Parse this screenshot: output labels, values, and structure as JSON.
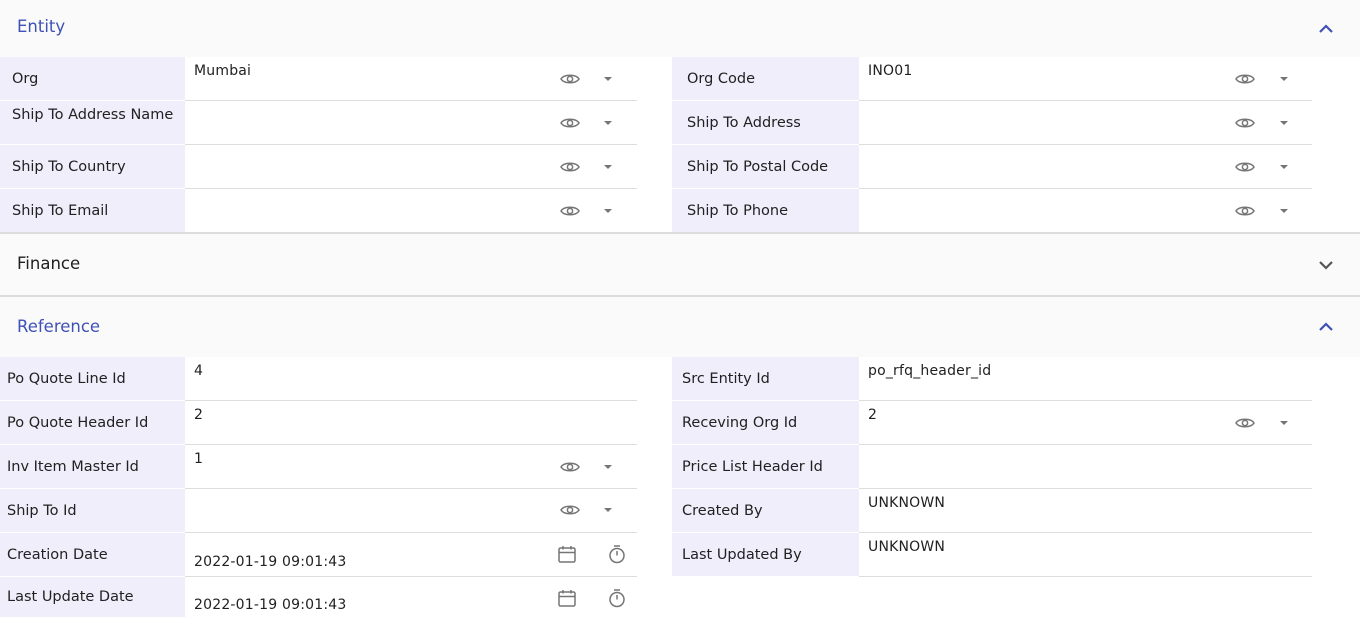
{
  "sections": {
    "entity": {
      "title": "Entity",
      "expanded": true
    },
    "finance": {
      "title": "Finance",
      "expanded": false
    },
    "reference": {
      "title": "Reference",
      "expanded": true
    }
  },
  "entity": {
    "org": {
      "label": "Org",
      "value": "Mumbai"
    },
    "org_code": {
      "label": "Org Code",
      "value": "INO01"
    },
    "ship_to_address_name": {
      "label": "Ship To Address Name",
      "value": ""
    },
    "ship_to_address": {
      "label": "Ship To Address",
      "value": ""
    },
    "ship_to_country": {
      "label": "Ship To Country",
      "value": ""
    },
    "ship_to_postal_code": {
      "label": "Ship To Postal Code",
      "value": ""
    },
    "ship_to_email": {
      "label": "Ship To Email",
      "value": ""
    },
    "ship_to_phone": {
      "label": "Ship To Phone",
      "value": ""
    }
  },
  "reference": {
    "po_quote_line_id": {
      "label": "Po Quote Line Id",
      "value": "4"
    },
    "src_entity_id": {
      "label": "Src Entity Id",
      "value": "po_rfq_header_id"
    },
    "po_quote_header_id": {
      "label": "Po Quote Header Id",
      "value": "2"
    },
    "receving_org_id": {
      "label": "Receving Org Id",
      "value": "2"
    },
    "inv_item_master_id": {
      "label": "Inv Item Master Id",
      "value": "1"
    },
    "price_list_header_id": {
      "label": "Price List Header Id",
      "value": ""
    },
    "ship_to_id": {
      "label": "Ship To Id",
      "value": ""
    },
    "created_by": {
      "label": "Created By",
      "value": "UNKNOWN"
    },
    "creation_date": {
      "label": "Creation Date",
      "value": "2022-01-19 09:01:43"
    },
    "last_updated_by": {
      "label": "Last Updated By",
      "value": "UNKNOWN"
    },
    "last_update_date": {
      "label": "Last Update Date",
      "value": "2022-01-19 09:01:43"
    }
  },
  "colors": {
    "accent": "#3f51b5",
    "label_bg": "#f1eefb",
    "header_bg": "#fafafa",
    "icon": "#757575"
  },
  "icons": [
    "chevron-up-icon",
    "chevron-down-icon",
    "eye-icon",
    "dropdown-arrow-icon",
    "calendar-icon",
    "timer-icon"
  ]
}
